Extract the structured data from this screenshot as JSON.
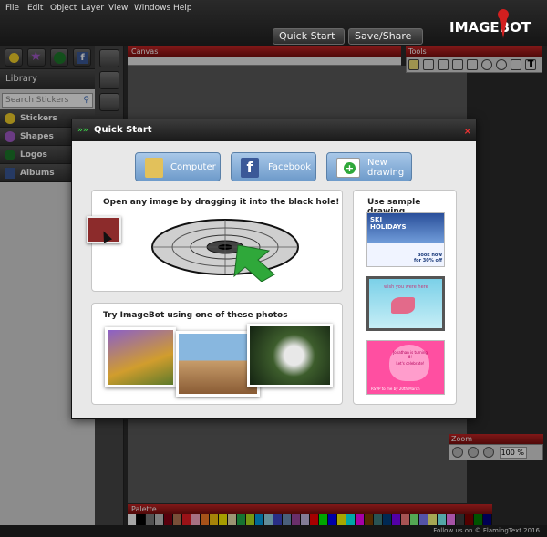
{
  "menu": [
    "File",
    "Edit",
    "Object",
    "Layer",
    "View",
    "Windows",
    "Help"
  ],
  "header": {
    "quick_start": "Quick Start",
    "quick_start_arrows": "»»",
    "save_share": "Save/Share",
    "logo": "IMAGEBOT"
  },
  "library": {
    "title": "Library",
    "search_placeholder": "Search Stickers",
    "items": [
      {
        "label": "Stickers",
        "icon": "smiley-icon"
      },
      {
        "label": "Shapes",
        "icon": "star-icon"
      },
      {
        "label": "Logos",
        "icon": "logo-badge-icon"
      },
      {
        "label": "Albums",
        "icon": "facebook-icon"
      }
    ]
  },
  "canvas": {
    "title": "Canvas"
  },
  "tools": {
    "title": "Tools"
  },
  "zoom": {
    "title": "Zoom",
    "value": "100 %"
  },
  "palette": {
    "title": "Palette",
    "colors": [
      "#ffffff",
      "#000000",
      "#7f7f7f",
      "#c3c3c3",
      "#880015",
      "#b97a57",
      "#ed1c24",
      "#ffaec9",
      "#ff7f27",
      "#ffc90e",
      "#fff200",
      "#efe4b0",
      "#22b14c",
      "#b5e61d",
      "#00a2e8",
      "#99d9ea",
      "#3f48cc",
      "#7092be",
      "#a349a4",
      "#c8bfe7",
      "#ff0000",
      "#00ff00",
      "#0000ff",
      "#ffff00",
      "#00ffff",
      "#ff00ff",
      "#804000",
      "#408080",
      "#004080",
      "#8000ff",
      "#ff8080",
      "#80ff80",
      "#8080ff",
      "#ffff80",
      "#80ffff",
      "#ff80ff",
      "#404040",
      "#800000",
      "#008000",
      "#000080"
    ]
  },
  "footer": "Follow us on  © FlamingText 2016",
  "dialog": {
    "title": "Quick Start",
    "title_arrows": "»»",
    "close": "×",
    "buttons": {
      "computer": "Computer",
      "facebook": "Facebook",
      "new_drawing": "New drawing"
    },
    "drop_title": "Open any image by dragging it into the black hole!",
    "try_title": "Try ImageBot using one of these photos",
    "sample_title": "Use sample drawing",
    "samples": [
      {
        "line1": "SKI",
        "line2": "HOLIDAYS",
        "line3": "Book now for 30% off"
      },
      {
        "line1": "wish you were here"
      },
      {
        "line1": "Jonathan is turning 8!",
        "line2": "Let's celebrate!",
        "line3": "RSVP to me by 20th March"
      }
    ]
  }
}
